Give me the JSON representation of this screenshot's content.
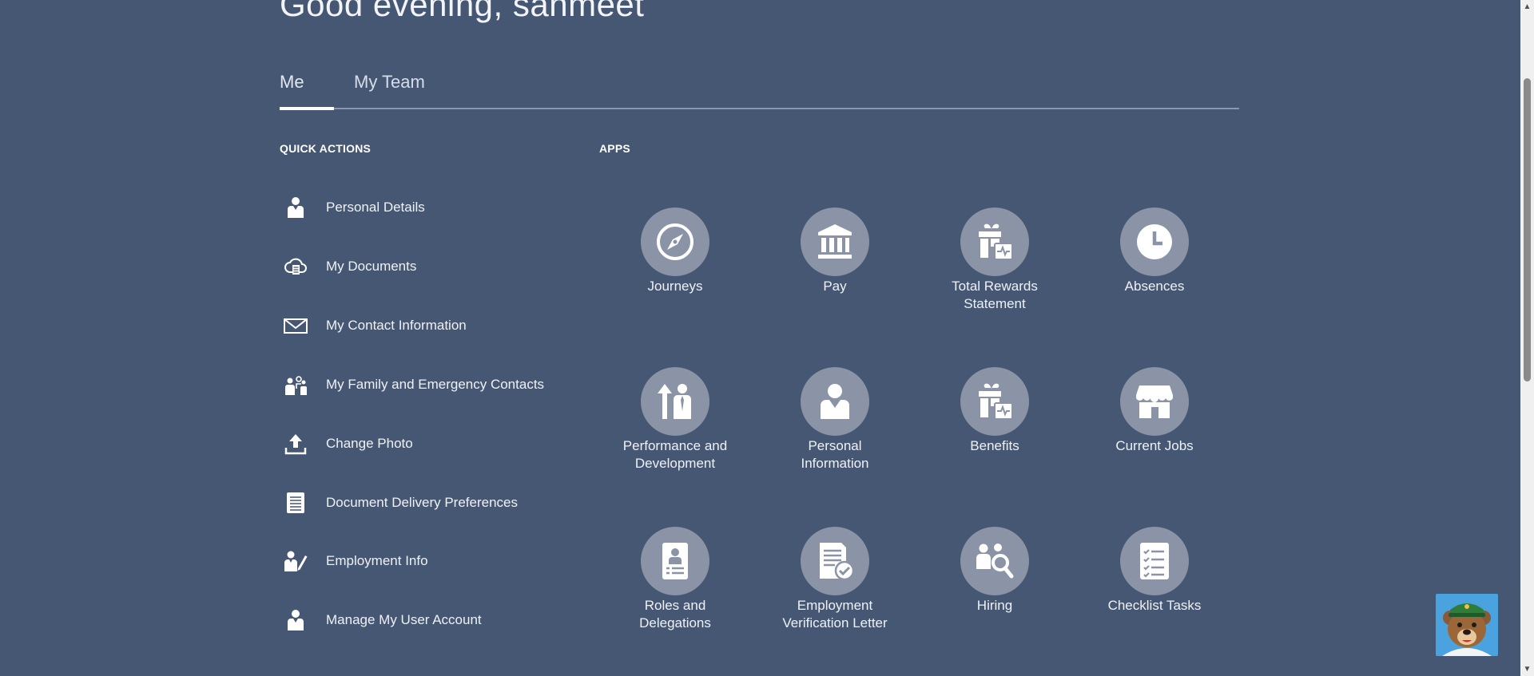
{
  "greeting": "Good evening, sanmeet",
  "tabs": [
    {
      "label": "Me",
      "active": true
    },
    {
      "label": "My Team",
      "active": false
    }
  ],
  "quick_actions": {
    "title": "QUICK ACTIONS",
    "items": [
      {
        "label": "Personal Details",
        "icon": "person-icon"
      },
      {
        "label": "My Documents",
        "icon": "cloud-document-icon"
      },
      {
        "label": "My Contact Information",
        "icon": "envelope-icon"
      },
      {
        "label": "My Family and Emergency Contacts",
        "icon": "family-icon"
      },
      {
        "label": "Change Photo",
        "icon": "upload-icon"
      },
      {
        "label": "Document Delivery Preferences",
        "icon": "document-lines-icon"
      },
      {
        "label": "Employment Info",
        "icon": "person-pencil-icon"
      },
      {
        "label": "Manage My User Account",
        "icon": "person-icon"
      }
    ]
  },
  "apps": {
    "title": "APPS",
    "items": [
      {
        "label": "Journeys",
        "icon": "compass-icon"
      },
      {
        "label": "Pay",
        "icon": "bank-icon"
      },
      {
        "label": "Total Rewards\nStatement",
        "icon": "gift-pulse-icon"
      },
      {
        "label": "Absences",
        "icon": "clock-icon"
      },
      {
        "label": "Performance and\nDevelopment",
        "icon": "growth-people-icon"
      },
      {
        "label": "Personal\nInformation",
        "icon": "person-icon"
      },
      {
        "label": "Benefits",
        "icon": "gift-pulse-icon"
      },
      {
        "label": "Current Jobs",
        "icon": "storefront-icon"
      },
      {
        "label": "Roles and\nDelegations",
        "icon": "id-badge-icon"
      },
      {
        "label": "Employment\nVerification Letter",
        "icon": "document-check-icon"
      },
      {
        "label": "Hiring",
        "icon": "people-search-icon"
      },
      {
        "label": "Checklist Tasks",
        "icon": "checklist-icon"
      }
    ]
  },
  "colors": {
    "background": "#465773",
    "app_circle": "#8a94a6",
    "text": "#ffffff"
  }
}
